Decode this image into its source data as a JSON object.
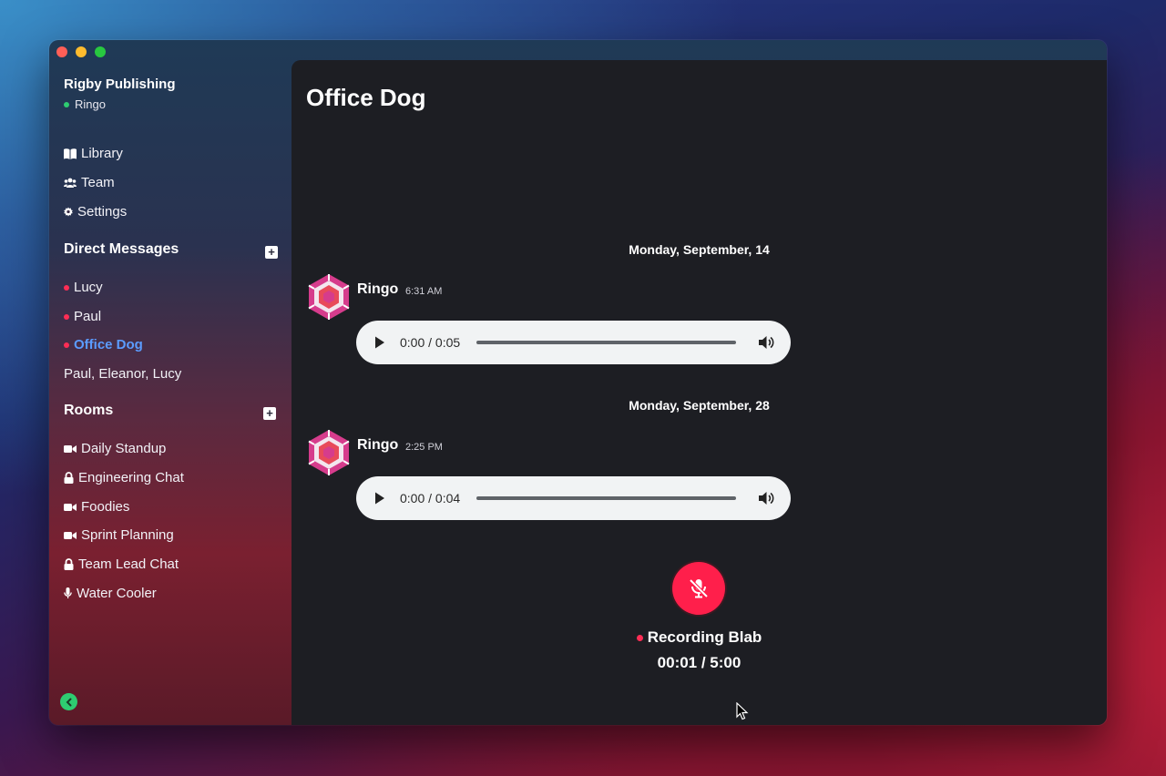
{
  "workspace": {
    "name": "Rigby Publishing",
    "user": "Ringo"
  },
  "nav": [
    {
      "label": "Library",
      "icon": "book-icon"
    },
    {
      "label": "Team",
      "icon": "users-icon"
    },
    {
      "label": "Settings",
      "icon": "gear-icon"
    }
  ],
  "direct_messages": {
    "title": "Direct Messages",
    "items": [
      {
        "label": "Lucy",
        "status": "red"
      },
      {
        "label": "Paul",
        "status": "red"
      },
      {
        "label": "Office Dog",
        "status": "red",
        "active": true
      },
      {
        "label": "Paul, Eleanor, Lucy"
      }
    ]
  },
  "rooms": {
    "title": "Rooms",
    "items": [
      {
        "label": "Daily Standup",
        "icon": "video-icon"
      },
      {
        "label": "Engineering Chat",
        "icon": "lock-icon"
      },
      {
        "label": "Foodies",
        "icon": "video-icon"
      },
      {
        "label": "Sprint Planning",
        "icon": "video-icon"
      },
      {
        "label": "Team Lead Chat",
        "icon": "lock-icon"
      },
      {
        "label": "Water Cooler",
        "icon": "mic-icon"
      }
    ]
  },
  "main": {
    "title": "Office Dog",
    "messages": [
      {
        "date": "Monday, September, 14",
        "author": "Ringo",
        "time": "6:31 AM",
        "audio_time": "0:00 / 0:05"
      },
      {
        "date": "Monday, September, 28",
        "author": "Ringo",
        "time": "2:25 PM",
        "audio_time": "0:00 / 0:04"
      }
    ],
    "recording": {
      "label": "Recording Blab",
      "time": "00:01 / 5:00"
    }
  },
  "colors": {
    "accent": "#5b9cff",
    "record": "#ff1f4b",
    "online": "#2ecc71",
    "offline": "#ff2d55"
  }
}
